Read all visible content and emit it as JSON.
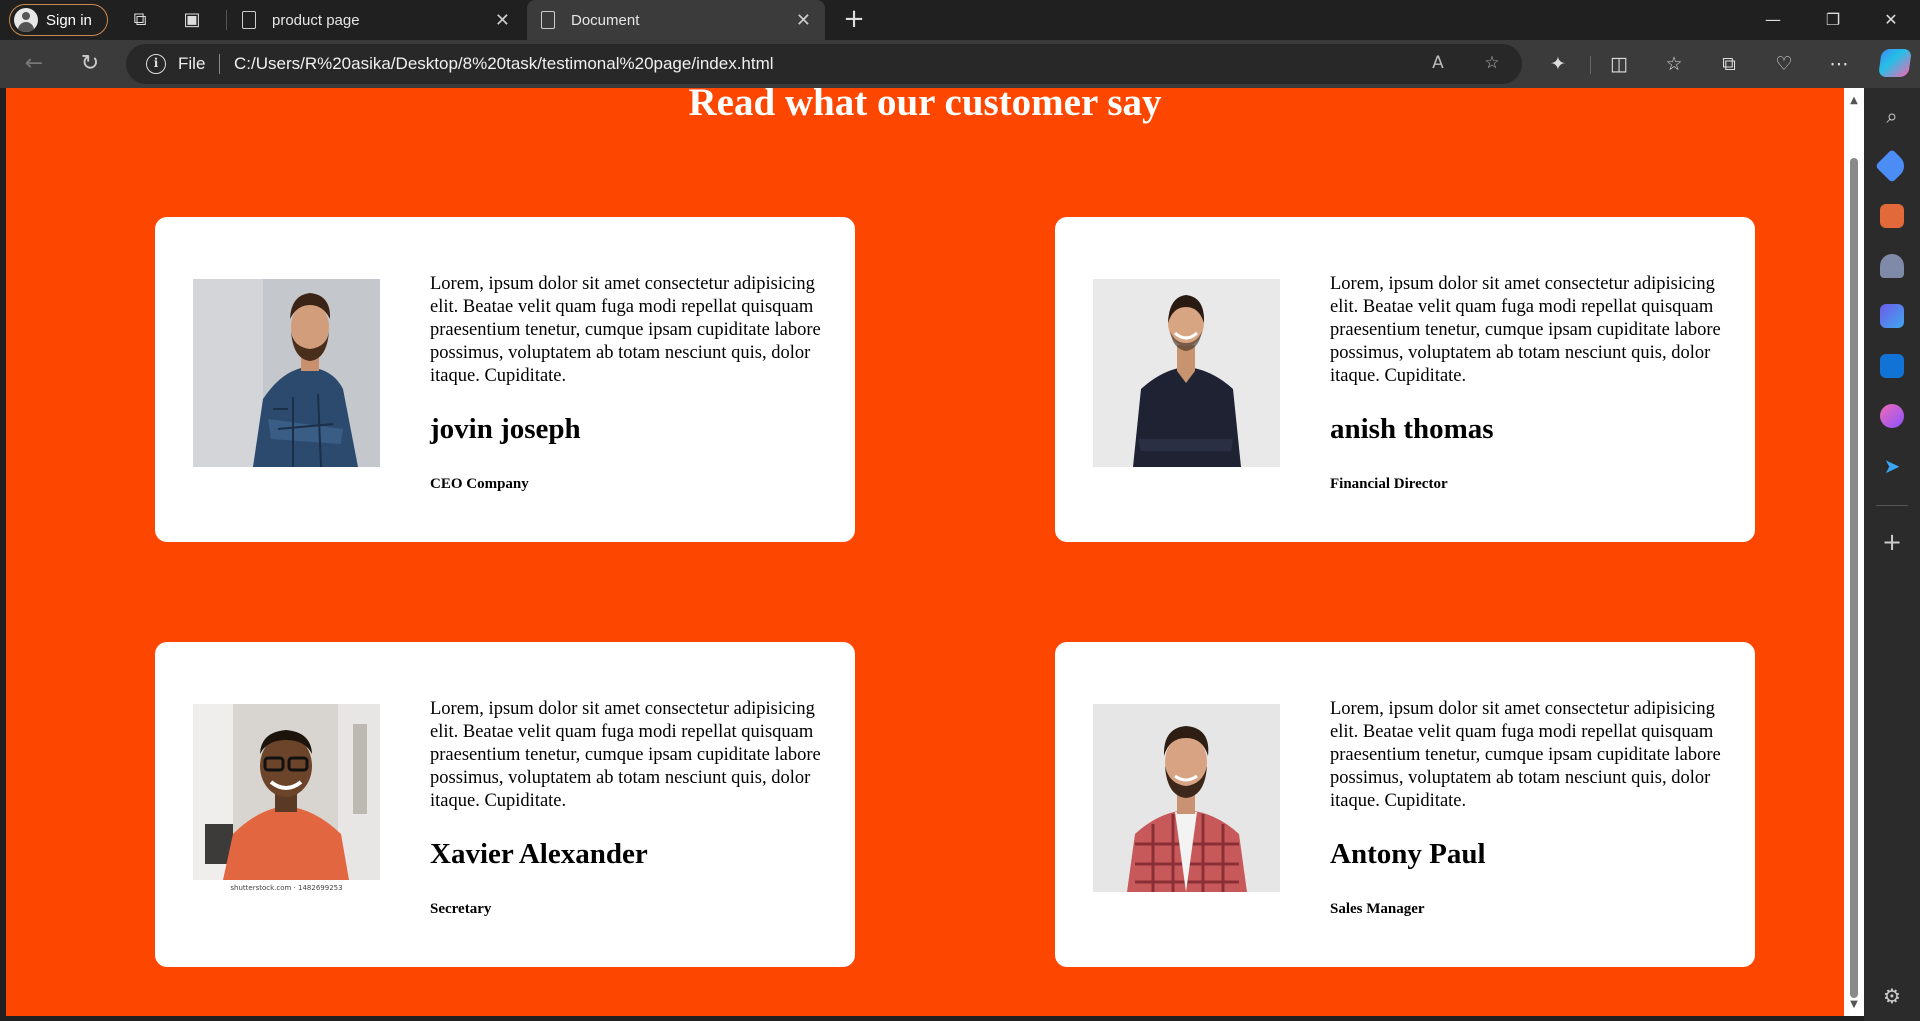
{
  "browser": {
    "signin_label": "Sign in",
    "tabs": [
      {
        "title": "product page",
        "active": false
      },
      {
        "title": "Document",
        "active": true
      }
    ],
    "address": {
      "scheme_label": "File",
      "url": "C:/Users/R%20asika/Desktop/8%20task/testimonal%20page/index.html"
    }
  },
  "page": {
    "heading": "Read what our customer say",
    "background_color": "#fd4600",
    "testimonials": [
      {
        "text": "Lorem, ipsum dolor sit amet consectetur adipisicing elit. Beatae velit quam fuga modi repellat quisquam praesentium tenetur, cumque ipsam cupiditate labore possimus, voluptatem ab totam nesciunt quis, dolor itaque. Cupiditate.",
        "name": "jovin joseph",
        "role": "CEO Company"
      },
      {
        "text": "Lorem, ipsum dolor sit amet consectetur adipisicing elit. Beatae velit quam fuga modi repellat quisquam praesentium tenetur, cumque ipsam cupiditate labore possimus, voluptatem ab totam nesciunt quis, dolor itaque. Cupiditate.",
        "name": "anish thomas",
        "role": "Financial Director"
      },
      {
        "text": "Lorem, ipsum dolor sit amet consectetur adipisicing elit. Beatae velit quam fuga modi repellat quisquam praesentium tenetur, cumque ipsam cupiditate labore possimus, voluptatem ab totam nesciunt quis, dolor itaque. Cupiditate.",
        "name": "Xavier Alexander",
        "role": "Secretary",
        "photo_watermark": "shutterstock.com · 1482699253"
      },
      {
        "text": "Lorem, ipsum dolor sit amet consectetur adipisicing elit. Beatae velit quam fuga modi repellat quisquam praesentium tenetur, cumque ipsam cupiditate labore possimus, voluptatem ab totam nesciunt quis, dolor itaque. Cupiditate.",
        "name": "Antony Paul",
        "role": "Sales Manager"
      }
    ]
  }
}
